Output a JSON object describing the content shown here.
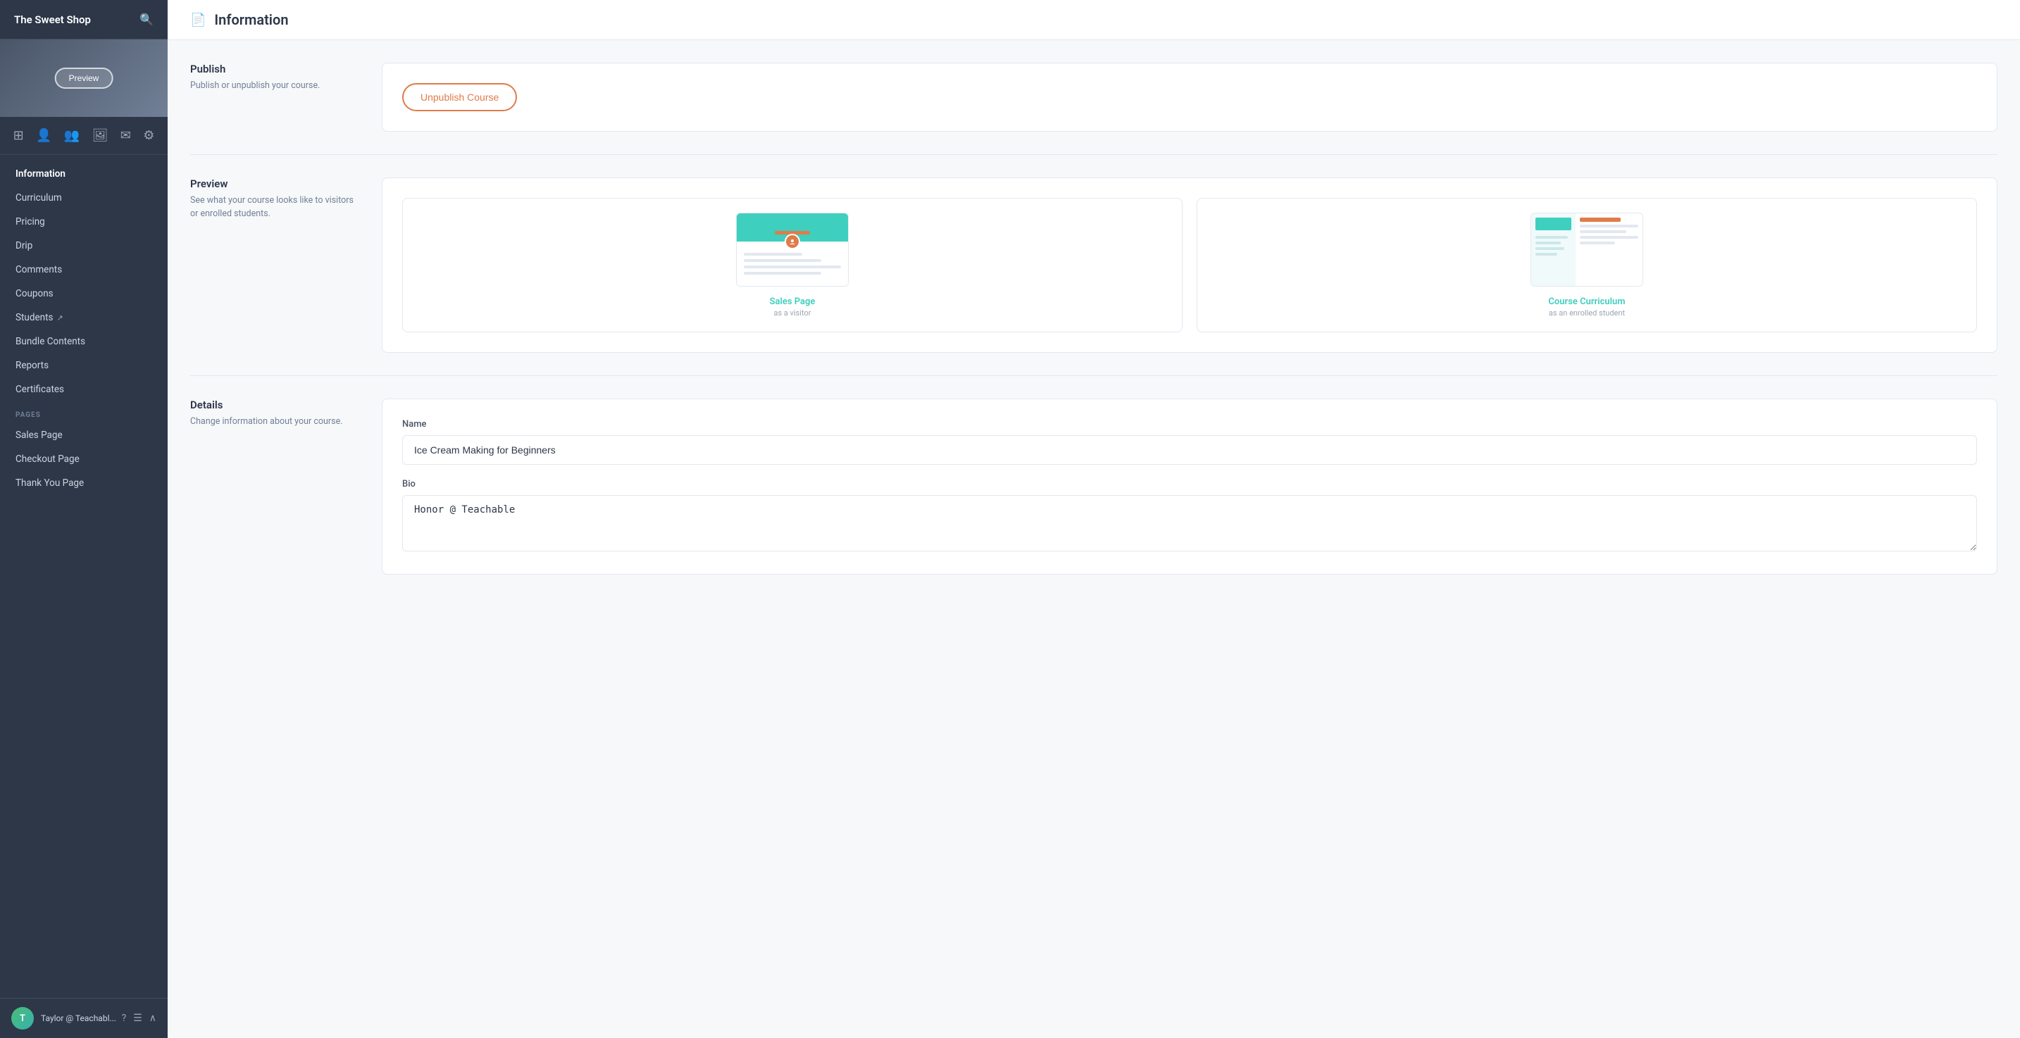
{
  "app": {
    "name": "The Sweet Shop"
  },
  "sidebar": {
    "title": "The Sweet Shop",
    "search_icon": "🔍",
    "preview_btn": "Preview",
    "nav_items": [
      {
        "label": "Information",
        "active": true,
        "has_ext": false
      },
      {
        "label": "Curriculum",
        "active": false,
        "has_ext": false
      },
      {
        "label": "Pricing",
        "active": false,
        "has_ext": false
      },
      {
        "label": "Drip",
        "active": false,
        "has_ext": false
      },
      {
        "label": "Comments",
        "active": false,
        "has_ext": false
      },
      {
        "label": "Coupons",
        "active": false,
        "has_ext": false
      },
      {
        "label": "Students",
        "active": false,
        "has_ext": true
      },
      {
        "label": "Bundle Contents",
        "active": false,
        "has_ext": false
      },
      {
        "label": "Reports",
        "active": false,
        "has_ext": false
      },
      {
        "label": "Certificates",
        "active": false,
        "has_ext": false
      }
    ],
    "pages_label": "PAGES",
    "pages_items": [
      {
        "label": "Sales Page"
      },
      {
        "label": "Checkout Page"
      },
      {
        "label": "Thank You Page"
      }
    ],
    "user": {
      "name": "Taylor @ Teachabl...",
      "avatar_initials": "T"
    }
  },
  "header": {
    "icon": "📄",
    "title": "Information"
  },
  "sections": {
    "publish": {
      "title": "Publish",
      "description": "Publish or unpublish your course.",
      "button_label": "Unpublish Course"
    },
    "preview": {
      "title": "Preview",
      "description": "See what your course looks like to visitors or enrolled students.",
      "cards": [
        {
          "label": "Sales Page",
          "sublabel": "as a visitor"
        },
        {
          "label": "Course Curriculum",
          "sublabel": "as an enrolled student"
        }
      ]
    },
    "details": {
      "title": "Details",
      "description": "Change information about your course.",
      "name_label": "Name",
      "name_value": "Ice Cream Making for Beginners",
      "bio_label": "Bio",
      "bio_value": "Honor @ Teachable"
    }
  }
}
